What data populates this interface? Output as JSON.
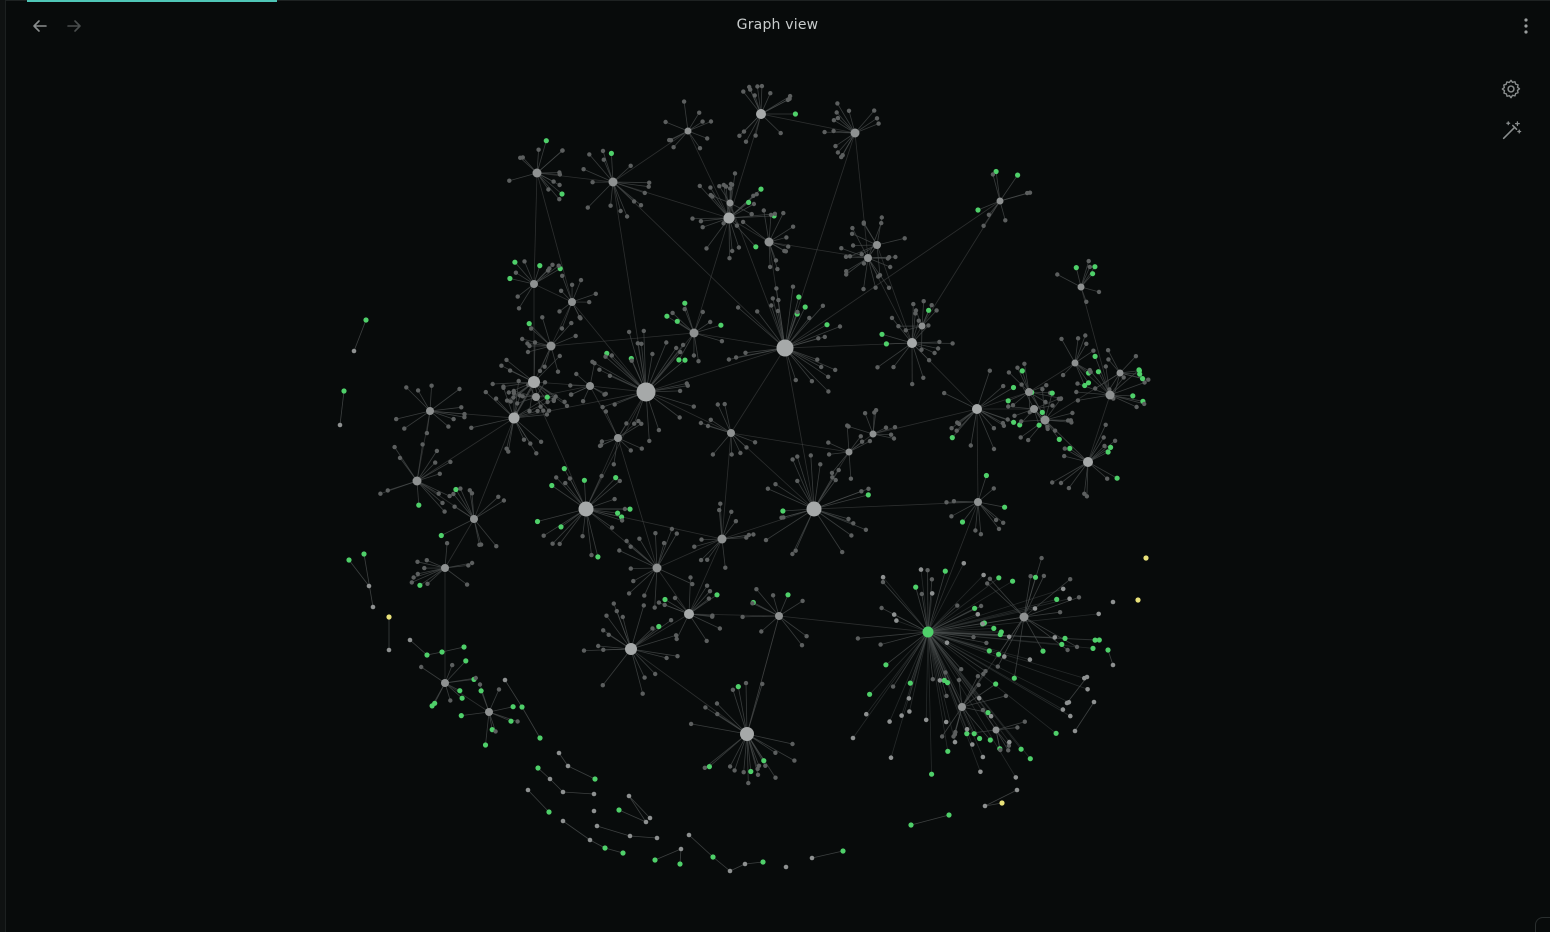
{
  "window": {
    "title": "Graph view"
  },
  "toolbar": {
    "back_icon": "arrow-left-icon",
    "forward_icon": "arrow-right-icon",
    "more_icon": "more-vertical-icon"
  },
  "graph_controls": {
    "settings_icon": "gear-icon",
    "animate_icon": "magic-wand-icon"
  },
  "colors": {
    "background": "#080b0b",
    "node_default": "#8e9191",
    "node_hub": "#a6a9a9",
    "node_leaf": "#5c5f5f",
    "node_attachment": "#4fd06a",
    "node_unresolved": "#e9e27a",
    "link": "#4a4d4d",
    "accent": "#4fc6b7"
  }
}
